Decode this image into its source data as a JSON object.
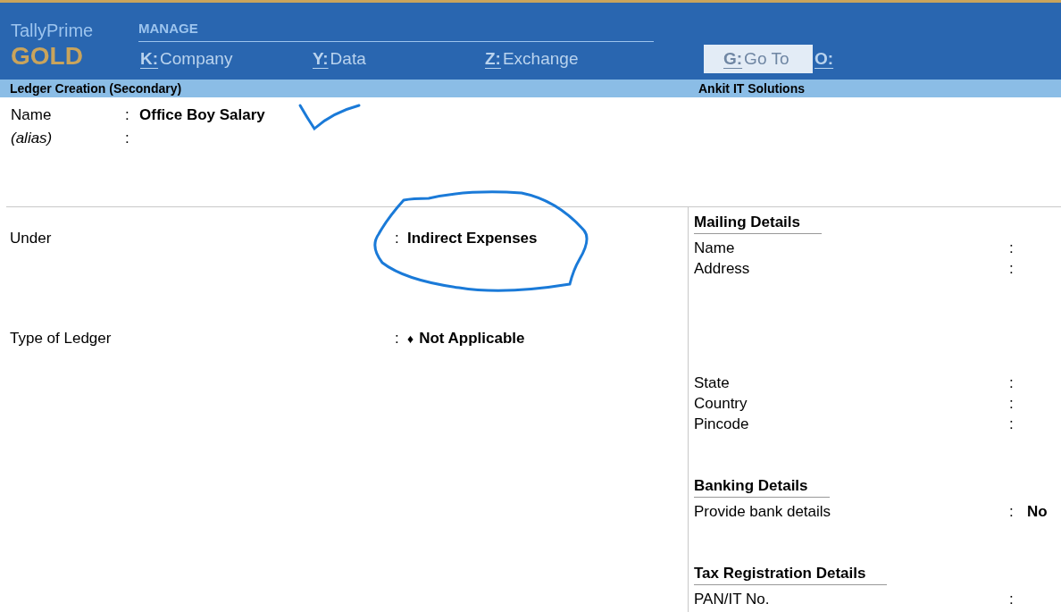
{
  "brand": {
    "product": "TallyPrime",
    "edition": "GOLD"
  },
  "menu": {
    "title": "MANAGE",
    "items": [
      {
        "key": "K:",
        "label": "Company",
        "disabled": false
      },
      {
        "key": "Y:",
        "label": "Data",
        "disabled": false
      },
      {
        "key": "Z:",
        "label": "Exchange",
        "disabled": false
      },
      {
        "key": "G:",
        "label": "Go To",
        "disabled": true
      },
      {
        "key": "O:",
        "disabled": false
      }
    ]
  },
  "subheader": {
    "screen": "Ledger Creation (Secondary)",
    "company": "Ankit IT Solutions"
  },
  "name_fields": [
    {
      "label": "Name",
      "colon": ":",
      "value": "Office Boy Salary",
      "italic": false
    },
    {
      "label": "(alias)",
      "colon": ":",
      "italic": true
    }
  ],
  "main_fields": [
    {
      "label": "Under",
      "colon": ":",
      "value": "Indirect Expenses"
    },
    {
      "label": "Type of Ledger",
      "colon": ":",
      "marker": "♦",
      "value": "Not Applicable"
    }
  ],
  "sections": [
    {
      "title": "Mailing Details",
      "rows": [
        {
          "label": "Name",
          "colon": ":",
          "kind": "line"
        },
        {
          "label": "Address",
          "colon": ":",
          "kind": "multiline"
        },
        {
          "label": "State",
          "colon": ":",
          "kind": "line"
        },
        {
          "label": "Country",
          "colon": ":",
          "kind": "line"
        },
        {
          "label": "Pincode",
          "colon": ":",
          "kind": "line"
        }
      ]
    },
    {
      "title": "Banking Details",
      "rows": [
        {
          "label": "Provide bank details",
          "colon": ":",
          "value": "No",
          "kind": "line"
        }
      ]
    },
    {
      "title": "Tax Registration Details",
      "rows": [
        {
          "label": "PAN/IT No.",
          "colon": ":",
          "kind": "line"
        }
      ]
    }
  ]
}
